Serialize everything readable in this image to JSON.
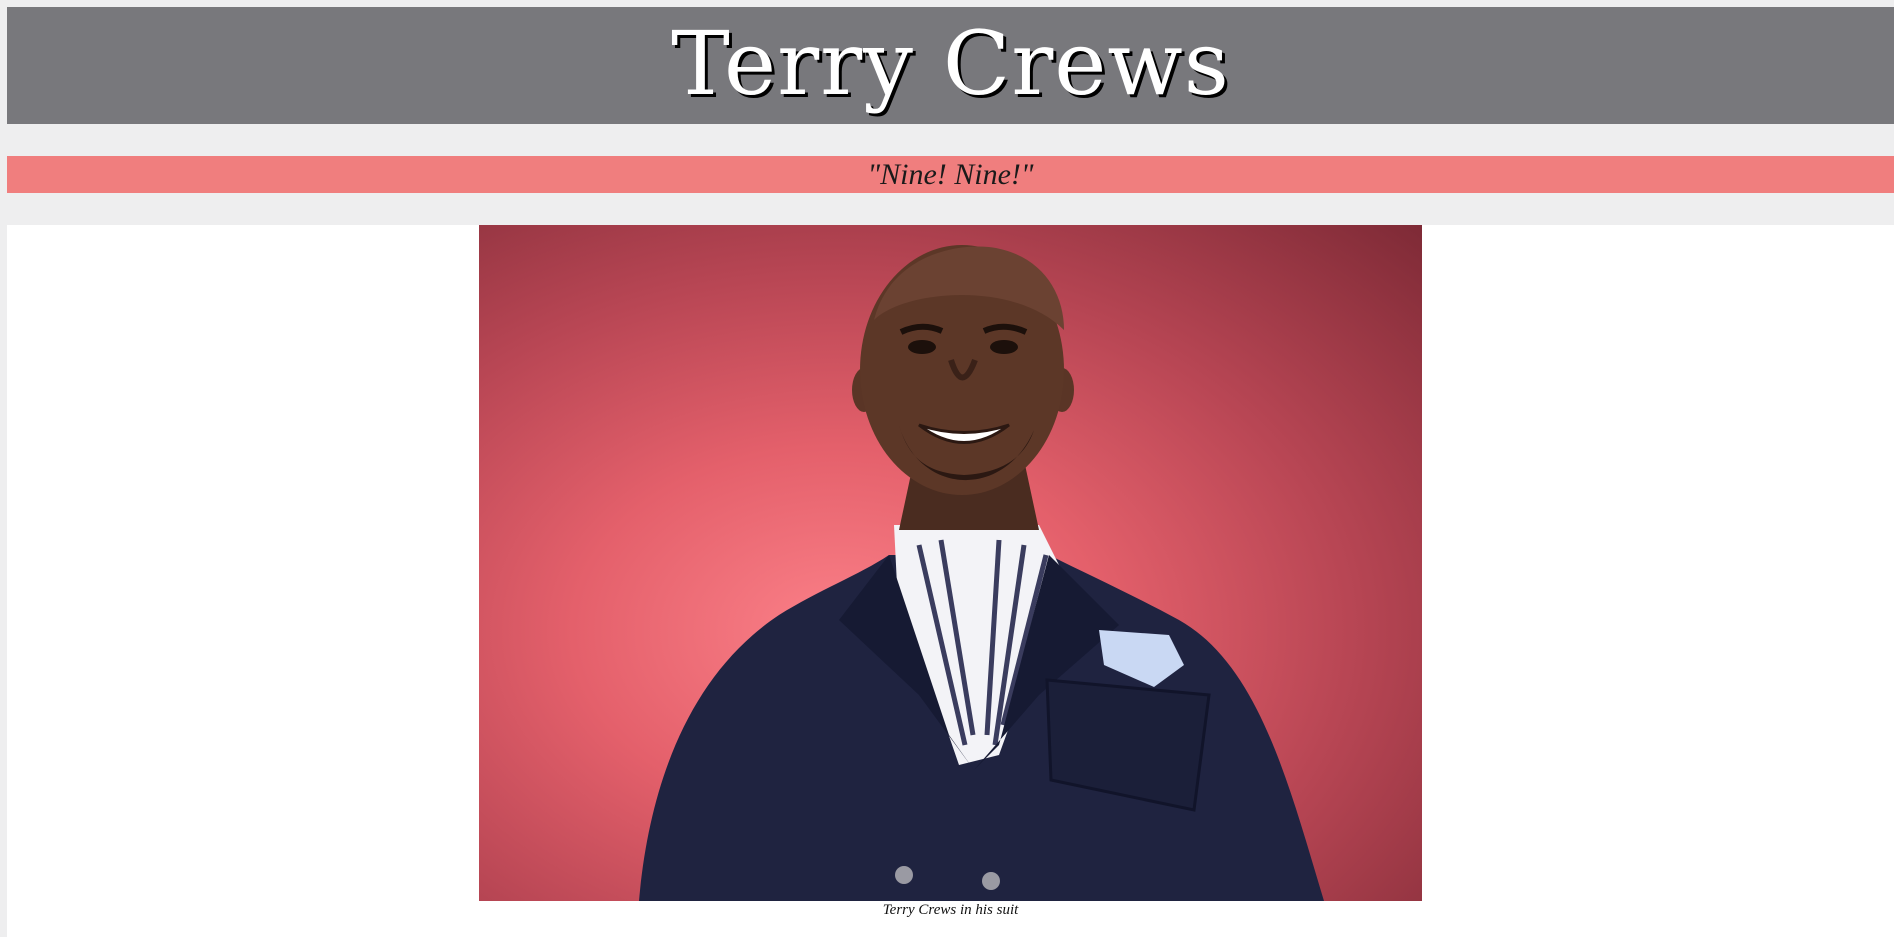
{
  "header": {
    "title": "Terry Crews"
  },
  "quote": {
    "text": "\"Nine! Nine!\""
  },
  "figure": {
    "image_subject": "Terry Crews portrait on red background",
    "caption": "Terry Crews in his suit"
  },
  "colors": {
    "page_background": "#eeeeef",
    "title_bar": "#78787c",
    "quote_bar": "#f07e7e",
    "content_background": "#ffffff"
  }
}
